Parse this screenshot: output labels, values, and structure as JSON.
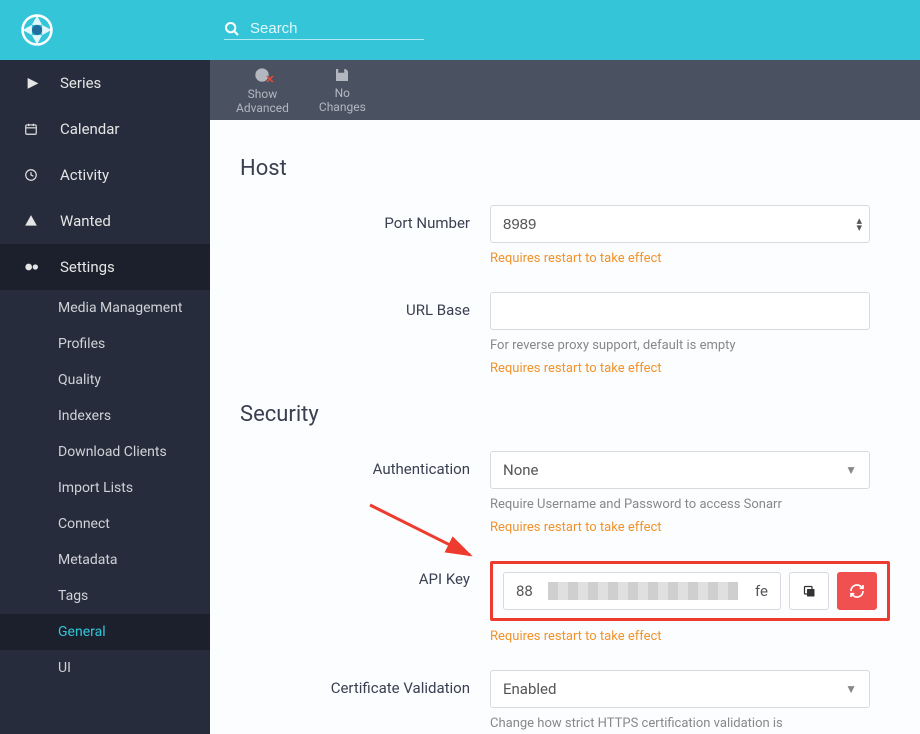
{
  "header": {
    "search_placeholder": "Search"
  },
  "nav": {
    "series": "Series",
    "calendar": "Calendar",
    "activity": "Activity",
    "wanted": "Wanted",
    "settings": "Settings",
    "subs": {
      "media": "Media Management",
      "profiles": "Profiles",
      "quality": "Quality",
      "indexers": "Indexers",
      "download": "Download Clients",
      "import": "Import Lists",
      "connect": "Connect",
      "metadata": "Metadata",
      "tags": "Tags",
      "general": "General",
      "ui": "UI"
    }
  },
  "toolbar": {
    "show_advanced_l1": "Show",
    "show_advanced_l2": "Advanced",
    "no_changes_l1": "No",
    "no_changes_l2": "Changes"
  },
  "sections": {
    "host": "Host",
    "security": "Security"
  },
  "fields": {
    "port_label": "Port Number",
    "port_value": "8989",
    "urlbase_label": "URL Base",
    "urlbase_value": "",
    "urlbase_help": "For reverse proxy support, default is empty",
    "auth_label": "Authentication",
    "auth_value": "None",
    "auth_help": "Require Username and Password to access Sonarr",
    "apikey_label": "API Key",
    "apikey_prefix": "88",
    "apikey_suffix": "fe",
    "cert_label": "Certificate Validation",
    "cert_value": "Enabled",
    "cert_help": "Change how strict HTTPS certification validation is",
    "restart_warn": "Requires restart to take effect"
  }
}
